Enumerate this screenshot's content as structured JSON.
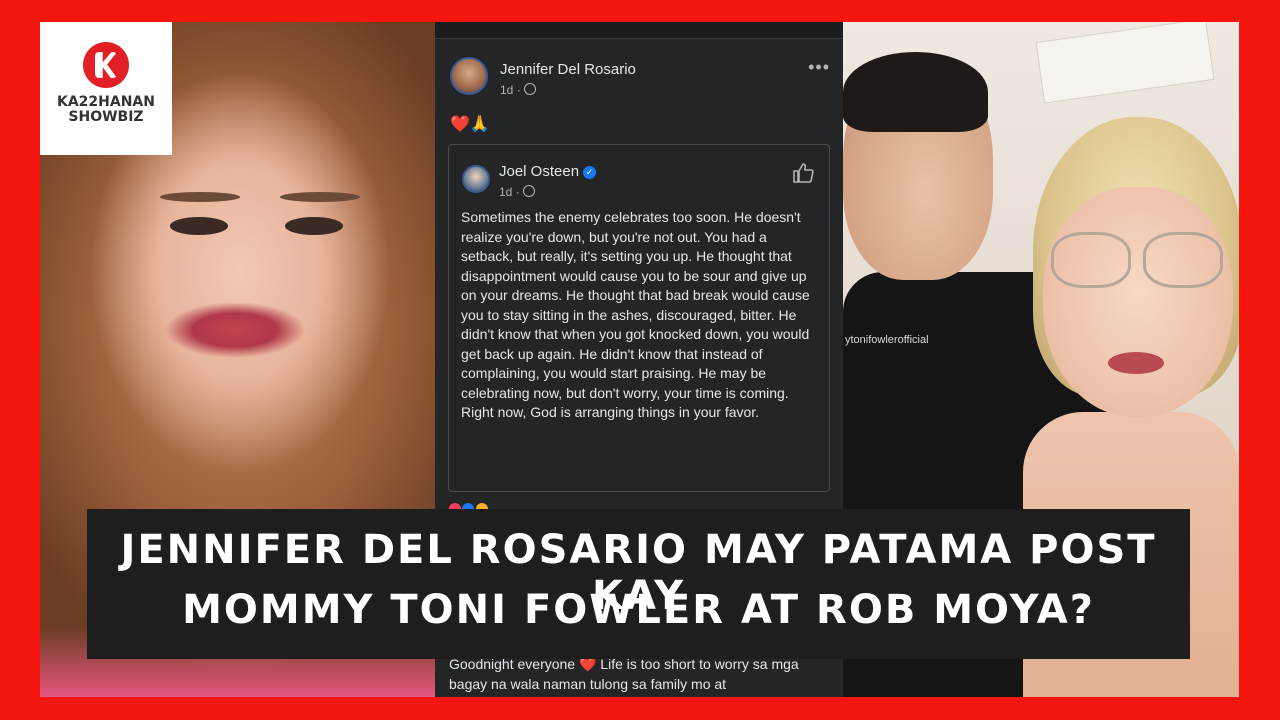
{
  "logo": {
    "text_line1": "KA22HANAN",
    "text_line2": "SHOWBIZ"
  },
  "post": {
    "author": "Jennifer Del Rosario",
    "time": "1d",
    "menu_icon": "more-horizontal-icon",
    "emoji_line": "❤️🙏",
    "shared": {
      "author": "Joel Osteen",
      "time": "1d",
      "text": "Sometimes the enemy celebrates too soon. He doesn't realize you're down, but you're not out. You had a setback, but really, it's setting you up. He thought that disappointment would cause you to be sour and give up on your dreams. He thought that bad break would cause you to stay sitting in the ashes, discouraged, bitter. He didn't know that when you got knocked down, you would get back up again. He didn't know that instead of complaining, you would start praising. He may be celebrating now, but don't worry, your time is coming. Right now, God is arranging things in your favor."
    },
    "bottom_text": "Goodnight everyone ❤️ Life is too short to worry sa mga bagay na wala naman tulong sa family mo at"
  },
  "photo_right": {
    "shirt_text": "ytonifowlerofficial"
  },
  "headline": {
    "line1": "JENNIFER DEL ROSARIO MAY PATAMA POST KAY",
    "line2": "MOMMY TONI FOWLER AT ROB MOYA?"
  },
  "colors": {
    "frame_red": "#f5160f",
    "banner_bg": "#1e1e1e",
    "fb_dark": "#242526",
    "verified_blue": "#1877f2"
  }
}
